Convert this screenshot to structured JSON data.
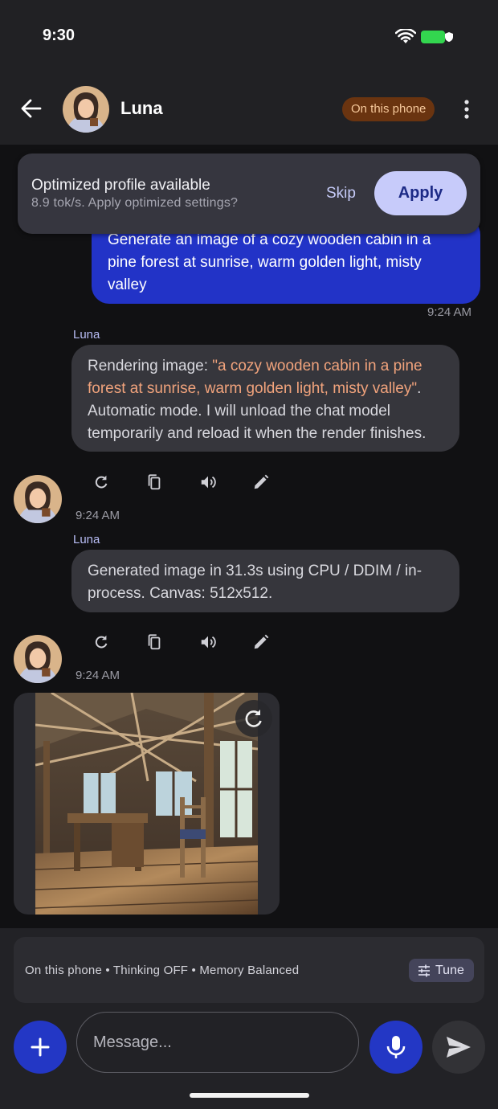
{
  "status_bar": {
    "time": "9:30"
  },
  "header": {
    "contact_name": "Luna",
    "location_badge": "On this phone"
  },
  "banner": {
    "title": "Optimized profile available",
    "subtitle": "8.9 tok/s. Apply optimized settings?",
    "skip_label": "Skip",
    "apply_label": "Apply"
  },
  "messages": {
    "user": {
      "text": "Generate an image of a cozy wooden cabin in a pine forest at sunrise, warm golden light, misty valley",
      "time": "9:24 AM"
    },
    "assistant_1": {
      "sender": "Luna",
      "text_prefix": "Rendering image: ",
      "text_highlight": "\"a cozy wooden cabin in a pine forest at sunrise, warm golden light, misty valley\"",
      "text_suffix": ". Automatic mode. I will unload the chat model temporarily and reload it when the render finishes.",
      "time": "9:24 AM"
    },
    "assistant_2": {
      "sender": "Luna",
      "text": "Generated image in 31.3s using CPU / DDIM / in-process. Canvas: 512x512.",
      "time": "9:24 AM"
    }
  },
  "message_actions": [
    "refresh-icon",
    "copy-icon",
    "speaker-icon",
    "edit-icon"
  ],
  "bottom": {
    "settings_text": "On this phone • Thinking OFF • Memory Balanced",
    "tune_label": "Tune",
    "input_placeholder": "Message..."
  },
  "colors": {
    "accent": "#2337c5",
    "user_bubble": "#2233c7",
    "assistant_bubble": "#36363c",
    "highlight_text": "#f1a37c",
    "badge_bg": "#6a3410"
  }
}
